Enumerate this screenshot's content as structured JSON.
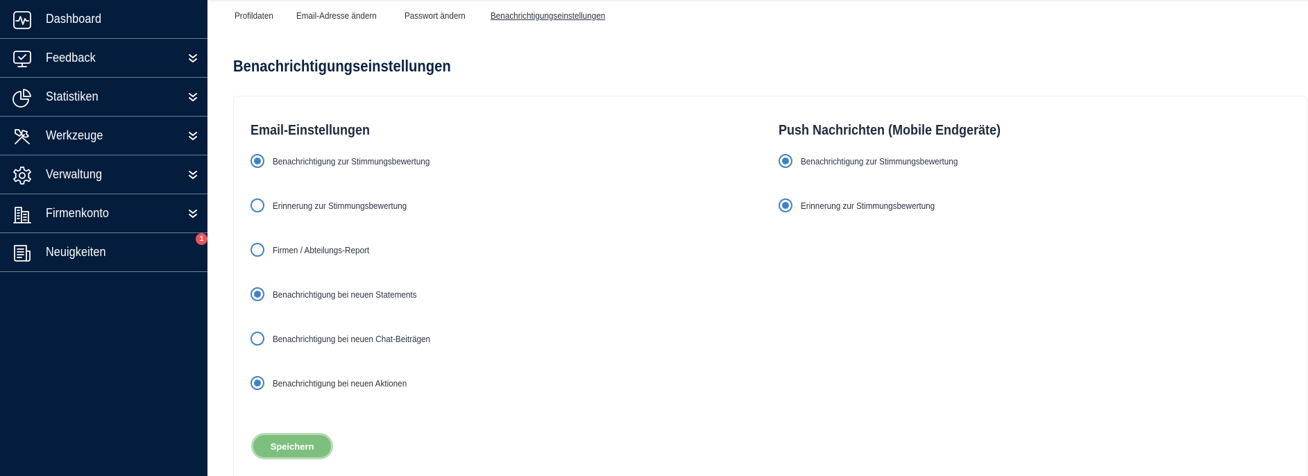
{
  "sidebar": {
    "items": [
      {
        "label": "Dashboard",
        "icon": "activity-monitor-icon",
        "has_submenu": false
      },
      {
        "label": "Feedback",
        "icon": "feedback-monitor-icon",
        "has_submenu": true
      },
      {
        "label": "Statistiken",
        "icon": "pie-chart-icon",
        "has_submenu": true
      },
      {
        "label": "Werkzeuge",
        "icon": "tools-icon",
        "has_submenu": true
      },
      {
        "label": "Verwaltung",
        "icon": "gear-icon",
        "has_submenu": true
      },
      {
        "label": "Firmenkonto",
        "icon": "building-icon",
        "has_submenu": true
      },
      {
        "label": "Neuigkeiten",
        "icon": "news-icon",
        "has_submenu": false
      }
    ],
    "news_badge": "1"
  },
  "tabs": [
    {
      "label": "Profildaten",
      "active": false
    },
    {
      "label": "Email-Adresse ändern",
      "active": false
    },
    {
      "label": "Passwort ändern",
      "active": false
    },
    {
      "label": "Benachrichtigungseinstellungen",
      "active": true
    }
  ],
  "page": {
    "title": "Benachrichtigungseinstellungen"
  },
  "email_settings": {
    "title": "Email-Einstellungen",
    "options": [
      {
        "label": "Benachrichtigung zur Stimmungsbewertung",
        "checked": true
      },
      {
        "label": "Erinnerung zur Stimmungsbewertung",
        "checked": false
      },
      {
        "label": "Firmen / Abteilungs-Report",
        "checked": false
      },
      {
        "label": "Benachrichtigung bei neuen Statements",
        "checked": true
      },
      {
        "label": "Benachrichtigung bei neuen Chat-Beiträgen",
        "checked": false
      },
      {
        "label": "Benachrichtigung bei neuen Aktionen",
        "checked": true
      }
    ]
  },
  "push_settings": {
    "title": "Push Nachrichten (Mobile Endgeräte)",
    "options": [
      {
        "label": "Benachrichtigung zur Stimmungsbewertung",
        "checked": true
      },
      {
        "label": "Erinnerung zur Stimmungsbewertung",
        "checked": true
      }
    ]
  },
  "save_button": {
    "label": "Speichern"
  },
  "colors": {
    "sidebar_bg": "#041d3c",
    "radio_accent": "#3f82c8",
    "save_button_bg": "#7dbf7e",
    "badge_bg": "#e8555c"
  }
}
